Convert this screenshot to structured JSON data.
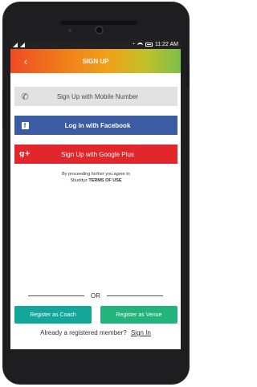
{
  "statusbar": {
    "time": "11:22",
    "ampm": "AM"
  },
  "appbar": {
    "title": "SIGN UP",
    "back_icon": "back-arrow-icon"
  },
  "buttons": {
    "mobile": {
      "label": "Sign Up with Mobile Number",
      "icon": "phone-icon"
    },
    "facebook": {
      "label": "Log in with Facebook",
      "icon": "facebook-icon",
      "color": "#3b5ba3"
    },
    "google": {
      "label": "Sign Up with Google Plus",
      "icon": "google-plus-icon",
      "color": "#e1262c"
    }
  },
  "terms": {
    "prefix": "By proceeding further you agree to",
    "brand": "Sbuddyz",
    "link": "TERMS OF USE"
  },
  "divider": {
    "label": "OR"
  },
  "register": {
    "coach": {
      "label": "Register as Coach",
      "color": "#12a79a"
    },
    "venue": {
      "label": "Register as Venue",
      "color": "#23b37d"
    }
  },
  "signin": {
    "prompt": "Already a registered member?",
    "link": "Sign In"
  }
}
